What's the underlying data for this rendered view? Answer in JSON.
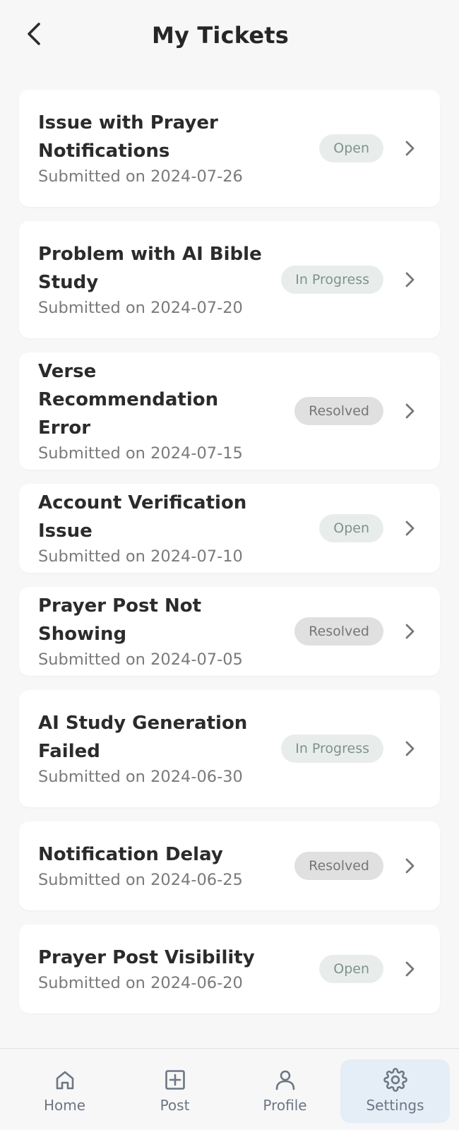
{
  "header": {
    "title": "My Tickets",
    "back_icon": "chevron-left-icon"
  },
  "tickets": [
    {
      "title": "Issue with Prayer Notifications",
      "date": "Submitted on 2024-07-26",
      "status": "Open"
    },
    {
      "title": "Problem with AI Bible Study",
      "date": "Submitted on 2024-07-20",
      "status": "In Progress"
    },
    {
      "title": "Verse Recommendation Error",
      "date": "Submitted on 2024-07-15",
      "status": "Resolved"
    },
    {
      "title": "Account Verification Issue",
      "date": "Submitted on 2024-07-10",
      "status": "Open"
    },
    {
      "title": "Prayer Post Not Showing",
      "date": "Submitted on 2024-07-05",
      "status": "Resolved"
    },
    {
      "title": "AI Study Generation Failed",
      "date": "Submitted on 2024-06-30",
      "status": "In Progress"
    },
    {
      "title": "Notification Delay",
      "date": "Submitted on 2024-06-25",
      "status": "Resolved"
    },
    {
      "title": "Prayer Post Visibility",
      "date": "Submitted on 2024-06-20",
      "status": "Open"
    }
  ],
  "nav": {
    "items": [
      {
        "label": "Home",
        "icon": "home-icon"
      },
      {
        "label": "Post",
        "icon": "plus-square-icon"
      },
      {
        "label": "Profile",
        "icon": "user-icon"
      },
      {
        "label": "Settings",
        "icon": "gear-icon"
      }
    ],
    "active": "Settings"
  },
  "colors": {
    "background": "#f7f7f7",
    "card": "#ffffff",
    "badge_open_bg": "#e8edeb",
    "badge_open_text": "#7e9389",
    "badge_resolved_bg": "#e0e0e0",
    "badge_resolved_text": "#767676",
    "nav_active_bg": "#e5edf6"
  }
}
